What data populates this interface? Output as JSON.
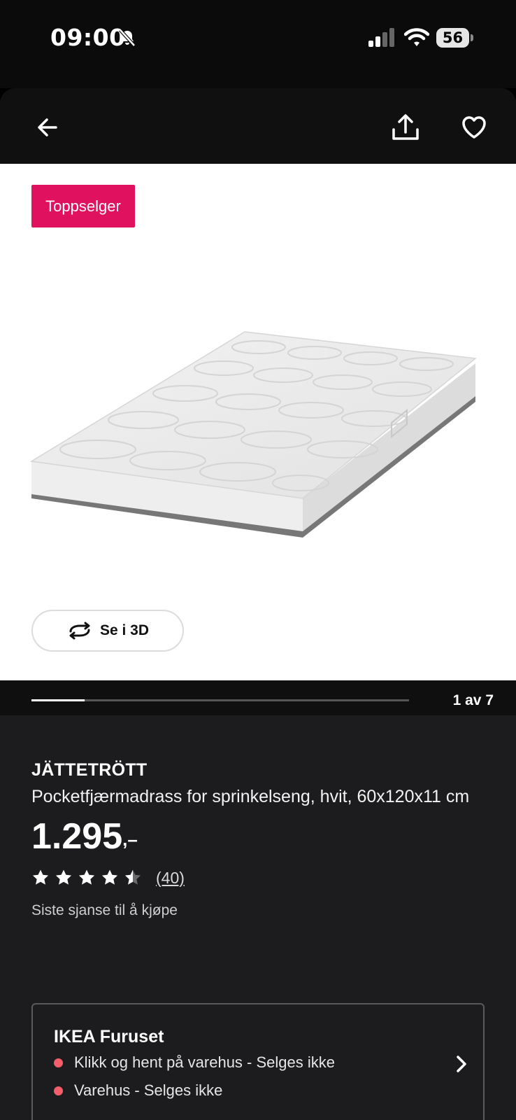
{
  "status_bar": {
    "time": "09:00",
    "battery": "56"
  },
  "badge": "Toppselger",
  "view_3d_label": "Se i 3D",
  "gallery": {
    "counter": "1 av 7",
    "progress_fraction": 0.14
  },
  "product": {
    "brand": "JÄTTETRÖTT",
    "description": "Pocketfjærmadrass for sprinkelseng, hvit, 60x120x11 cm",
    "price_main": "1.295",
    "price_suffix": ",–",
    "rating_stars": 4.5,
    "review_count": "(40)",
    "availability_note": "Siste sjanse til å kjøpe"
  },
  "store": {
    "name": "IKEA Furuset",
    "lines": [
      "Klikk og hent på varehus - Selges ikke",
      "Varehus - Selges ikke"
    ],
    "status_color": "#f25f6b"
  },
  "colors": {
    "badge": "#e0115f",
    "background": "#1c1c1e"
  }
}
